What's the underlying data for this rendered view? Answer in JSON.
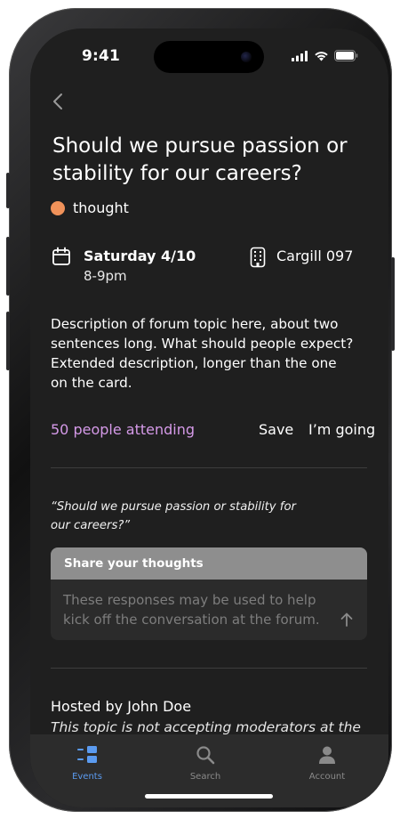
{
  "status_bar": {
    "time": "9:41"
  },
  "event": {
    "title": "Should we pursue passion or stability for our careers?",
    "tag": {
      "label": "thought",
      "color": "#f0925a"
    },
    "date": "Saturday 4/10",
    "time_range": "8-9pm",
    "location": "Cargill 097",
    "description": "Description of forum topic here, about two sentences long. What should people expect? Extended description, longer than the one on the card.",
    "attending": "50 people attending",
    "save_label": "Save",
    "going_label": "I’m going"
  },
  "thoughts": {
    "quote": "“Should we pursue passion or stability for our careers?”",
    "header": "Share your thoughts",
    "placeholder": "These responses may be used to help kick off the conversation at the forum."
  },
  "host": {
    "hosted_by": "Hosted by John Doe",
    "moderators_note": "This topic is not accepting moderators at the"
  },
  "tabs": [
    {
      "label": "Events",
      "icon": "events-icon",
      "active": true
    },
    {
      "label": "Search",
      "icon": "search-icon",
      "active": false
    },
    {
      "label": "Account",
      "icon": "account-icon",
      "active": false
    }
  ],
  "colors": {
    "accent": "#5b9bf0",
    "attending": "#d59ae8",
    "background": "#1f1f1f"
  }
}
